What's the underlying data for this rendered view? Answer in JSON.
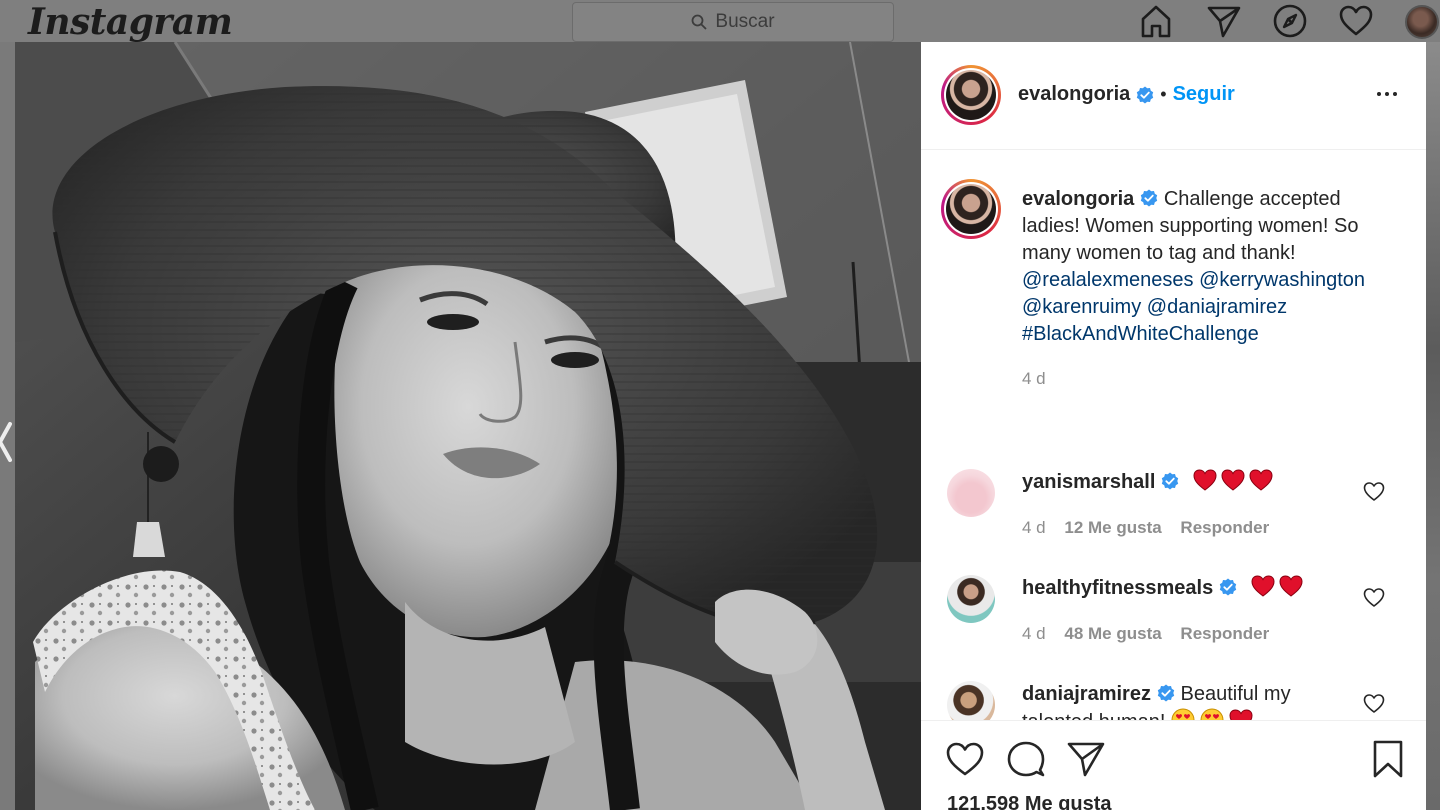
{
  "nav": {
    "logo": "Instagram",
    "search_placeholder": "Buscar",
    "icons": [
      "home-icon",
      "direct-icon",
      "explore-icon",
      "activity-icon",
      "profile-avatar"
    ]
  },
  "post": {
    "author": "evalongoria",
    "follow_label": "Seguir",
    "separator": "•",
    "caption_text": "Challenge accepted ladies! Women supporting women! So many women to tag and thank!",
    "mentions": [
      "@realalexmeneses",
      "@kerrywashington",
      "@karenruimy",
      "@daniajramirez"
    ],
    "hashtag": "#BlackAndWhiteChallenge",
    "time": "4 d",
    "likes": "121,598 Me gusta"
  },
  "comments": [
    {
      "user": "yanismarshall",
      "verified": true,
      "text": "",
      "emojis": "heart heart heart",
      "time": "4 d",
      "likes": "12 Me gusta",
      "reply": "Responder"
    },
    {
      "user": "healthyfitnessmeals",
      "verified": true,
      "text": "",
      "emojis": "heart heart",
      "time": "4 d",
      "likes": "48 Me gusta",
      "reply": "Responder"
    },
    {
      "user": "daniajramirez",
      "verified": true,
      "text": "Beautiful my talented human!",
      "emojis": "heart-eyes heart-eyes heart"
    }
  ],
  "colors": {
    "follow": "#0095f6",
    "verified": "#3897f0",
    "mention": "#00376b",
    "meta": "#8e8e8e",
    "heart": "#e0102b"
  }
}
